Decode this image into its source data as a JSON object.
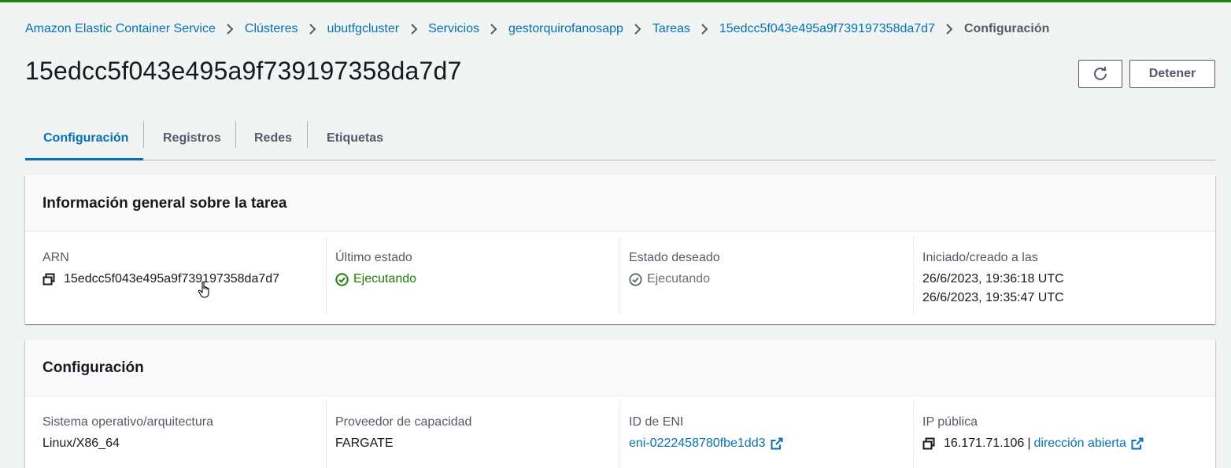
{
  "breadcrumb": [
    {
      "label": "Amazon Elastic Container Service"
    },
    {
      "label": "Clústeres"
    },
    {
      "label": "ubutfgcluster"
    },
    {
      "label": "Servicios"
    },
    {
      "label": "gestorquirofanosapp"
    },
    {
      "label": "Tareas"
    },
    {
      "label": "15edcc5f043e495a9f739197358da7d7"
    }
  ],
  "breadcrumb_current": "Configuración",
  "page_title": "15edcc5f043e495a9f739197358da7d7",
  "actions": {
    "refresh_icon": "refresh-icon",
    "stop_label": "Detener"
  },
  "tabs": [
    {
      "label": "Configuración",
      "active": true
    },
    {
      "label": "Registros"
    },
    {
      "label": "Redes"
    },
    {
      "label": "Etiquetas"
    }
  ],
  "overview": {
    "title": "Información general sobre la tarea",
    "arn": {
      "label": "ARN",
      "value": "15edcc5f043e495a9f739197358da7d7"
    },
    "last_status": {
      "label": "Último estado",
      "value": "Ejecutando"
    },
    "desired_status": {
      "label": "Estado deseado",
      "value": "Ejecutando"
    },
    "started": {
      "label": "Iniciado/creado a las",
      "started_at": "26/6/2023, 19:36:18 UTC",
      "created_at": "26/6/2023, 19:35:47 UTC"
    }
  },
  "configuration": {
    "title": "Configuración",
    "os": {
      "label": "Sistema operativo/arquitectura",
      "value": "Linux/X86_64"
    },
    "capacity": {
      "label": "Proveedor de capacidad",
      "value": "FARGATE"
    },
    "eni": {
      "label": "ID de ENI",
      "value": "eni-0222458780fbe1dd3"
    },
    "public_ip": {
      "label": "IP pública",
      "value": "16.171.71.106",
      "separator": "|",
      "link": "dirección abierta"
    }
  },
  "colors": {
    "link": "#0073bb",
    "success": "#1d8102",
    "muted": "#687078",
    "top_bar": "#1d8102"
  }
}
